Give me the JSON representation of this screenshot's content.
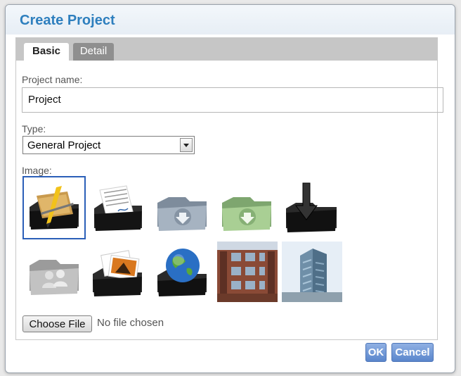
{
  "dialog": {
    "title": "Create Project"
  },
  "tabs": [
    {
      "label": "Basic",
      "active": true
    },
    {
      "label": "Detail",
      "active": false
    }
  ],
  "form": {
    "project_name_label": "Project name:",
    "project_name_value": "Project",
    "type_label": "Type:",
    "type_selected": "General Project",
    "image_label": "Image:"
  },
  "images": [
    {
      "icon": "project-tools-folder-icon",
      "selected": true
    },
    {
      "icon": "documents-folder-icon",
      "selected": false
    },
    {
      "icon": "download-folder-grey-icon",
      "selected": false
    },
    {
      "icon": "download-folder-green-icon",
      "selected": false
    },
    {
      "icon": "black-download-folder-icon",
      "selected": false
    },
    {
      "icon": "users-folder-icon",
      "selected": false
    },
    {
      "icon": "photos-folder-icon",
      "selected": false
    },
    {
      "icon": "globe-folder-icon",
      "selected": false
    },
    {
      "icon": "brick-building-photo",
      "selected": false
    },
    {
      "icon": "glass-building-photo",
      "selected": false
    }
  ],
  "file": {
    "button_label": "Choose File",
    "status": "No file chosen"
  },
  "actions": {
    "ok_label": "OK",
    "cancel_label": "Cancel"
  },
  "colors": {
    "title": "#2e7fbe",
    "selected_outline": "#2b5fb8",
    "button_bg": "#6f96d6"
  }
}
